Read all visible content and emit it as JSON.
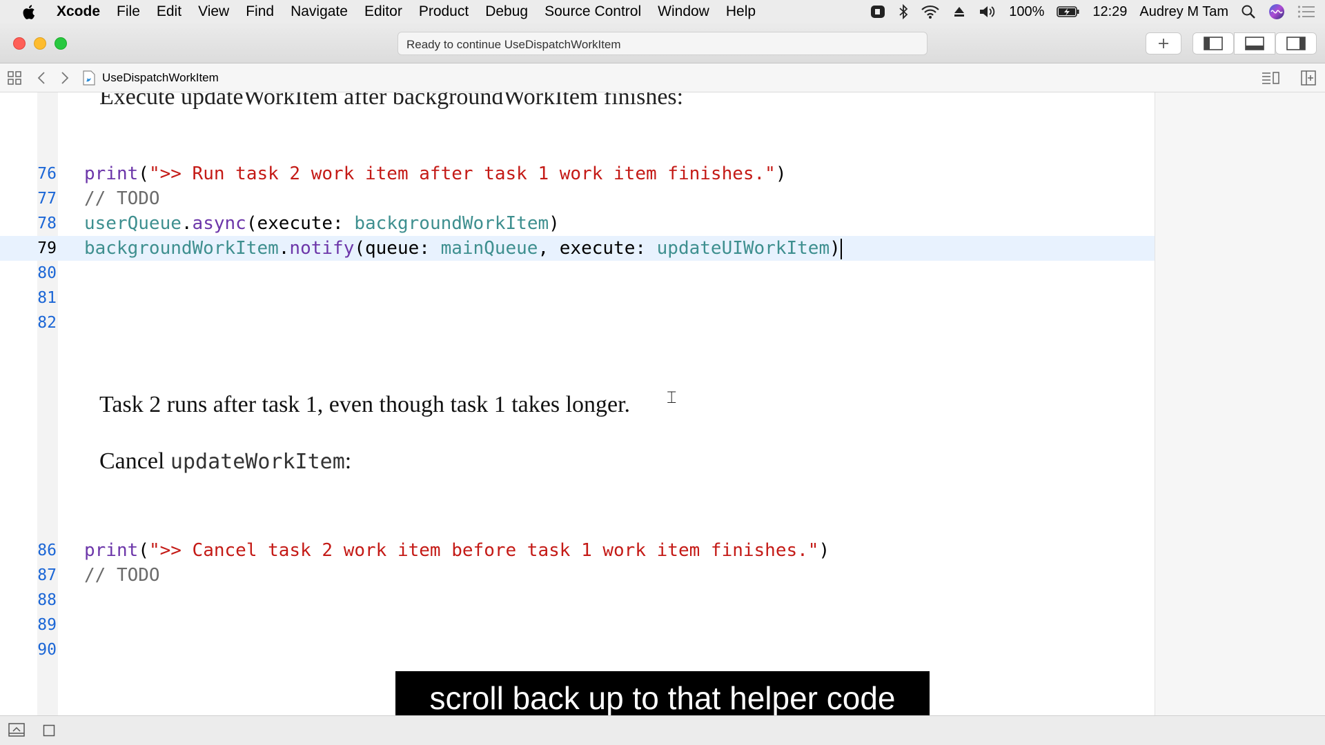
{
  "menubar": {
    "app_name": "Xcode",
    "items": [
      "File",
      "Edit",
      "View",
      "Find",
      "Navigate",
      "Editor",
      "Product",
      "Debug",
      "Source Control",
      "Window",
      "Help"
    ],
    "battery": "100%",
    "time": "12:29",
    "user": "Audrey M Tam"
  },
  "toolbar": {
    "activity_text": "Ready to continue UseDispatchWorkItem"
  },
  "jumpbar": {
    "file_name": "UseDispatchWorkItem"
  },
  "editor": {
    "cut_prose": "Execute updateWorkItem after backgroundWorkItem finishes:",
    "lines": [
      {
        "num": "76",
        "tokens": [
          {
            "t": "print",
            "c": "t-call"
          },
          {
            "t": "(",
            "c": "t-plain"
          },
          {
            "t": "\">> Run task 2 work item after task 1 work item finishes.\"",
            "c": "t-str"
          },
          {
            "t": ")",
            "c": "t-plain"
          }
        ]
      },
      {
        "num": "77",
        "tokens": [
          {
            "t": "// TODO",
            "c": "t-com"
          }
        ]
      },
      {
        "num": "78",
        "tokens": [
          {
            "t": "userQueue",
            "c": "t-id"
          },
          {
            "t": ".",
            "c": "t-plain"
          },
          {
            "t": "async",
            "c": "t-call"
          },
          {
            "t": "(execute: ",
            "c": "t-plain"
          },
          {
            "t": "backgroundWorkItem",
            "c": "t-id"
          },
          {
            "t": ")",
            "c": "t-plain"
          }
        ]
      },
      {
        "num": "79",
        "tokens": [
          {
            "t": "backgroundWorkItem",
            "c": "t-id"
          },
          {
            "t": ".",
            "c": "t-plain"
          },
          {
            "t": "notify",
            "c": "t-call"
          },
          {
            "t": "(queue: ",
            "c": "t-plain"
          },
          {
            "t": "mainQueue",
            "c": "t-id"
          },
          {
            "t": ", execute: ",
            "c": "t-plain"
          },
          {
            "t": "updateUIWorkItem",
            "c": "t-id"
          },
          {
            "t": ")",
            "c": "t-plain"
          }
        ],
        "current": true
      },
      {
        "num": "80",
        "tokens": []
      },
      {
        "num": "81",
        "tokens": []
      },
      {
        "num": "82",
        "tokens": []
      },
      {
        "num": "86",
        "tokens": [
          {
            "t": "print",
            "c": "t-call"
          },
          {
            "t": "(",
            "c": "t-plain"
          },
          {
            "t": "\">> Cancel task 2 work item before task 1 work item finishes.\"",
            "c": "t-str"
          },
          {
            "t": ")",
            "c": "t-plain"
          }
        ]
      },
      {
        "num": "87",
        "tokens": [
          {
            "t": "// TODO",
            "c": "t-com"
          }
        ]
      },
      {
        "num": "88",
        "tokens": []
      },
      {
        "num": "89",
        "tokens": []
      },
      {
        "num": "90",
        "tokens": []
      }
    ],
    "prose_1": "Task 2 runs after task 1, even though task 1 takes longer.",
    "prose_2_text": "Cancel ",
    "prose_2_code": "updateWorkItem",
    "prose_2_end": ":"
  },
  "subtitle": "scroll back up to that helper code",
  "colors": {
    "string": "#c41a16",
    "identifier": "#3e8f8f",
    "call": "#6c36a9",
    "line_number": "#1b66d6",
    "current_line": "#e8f2fe"
  }
}
